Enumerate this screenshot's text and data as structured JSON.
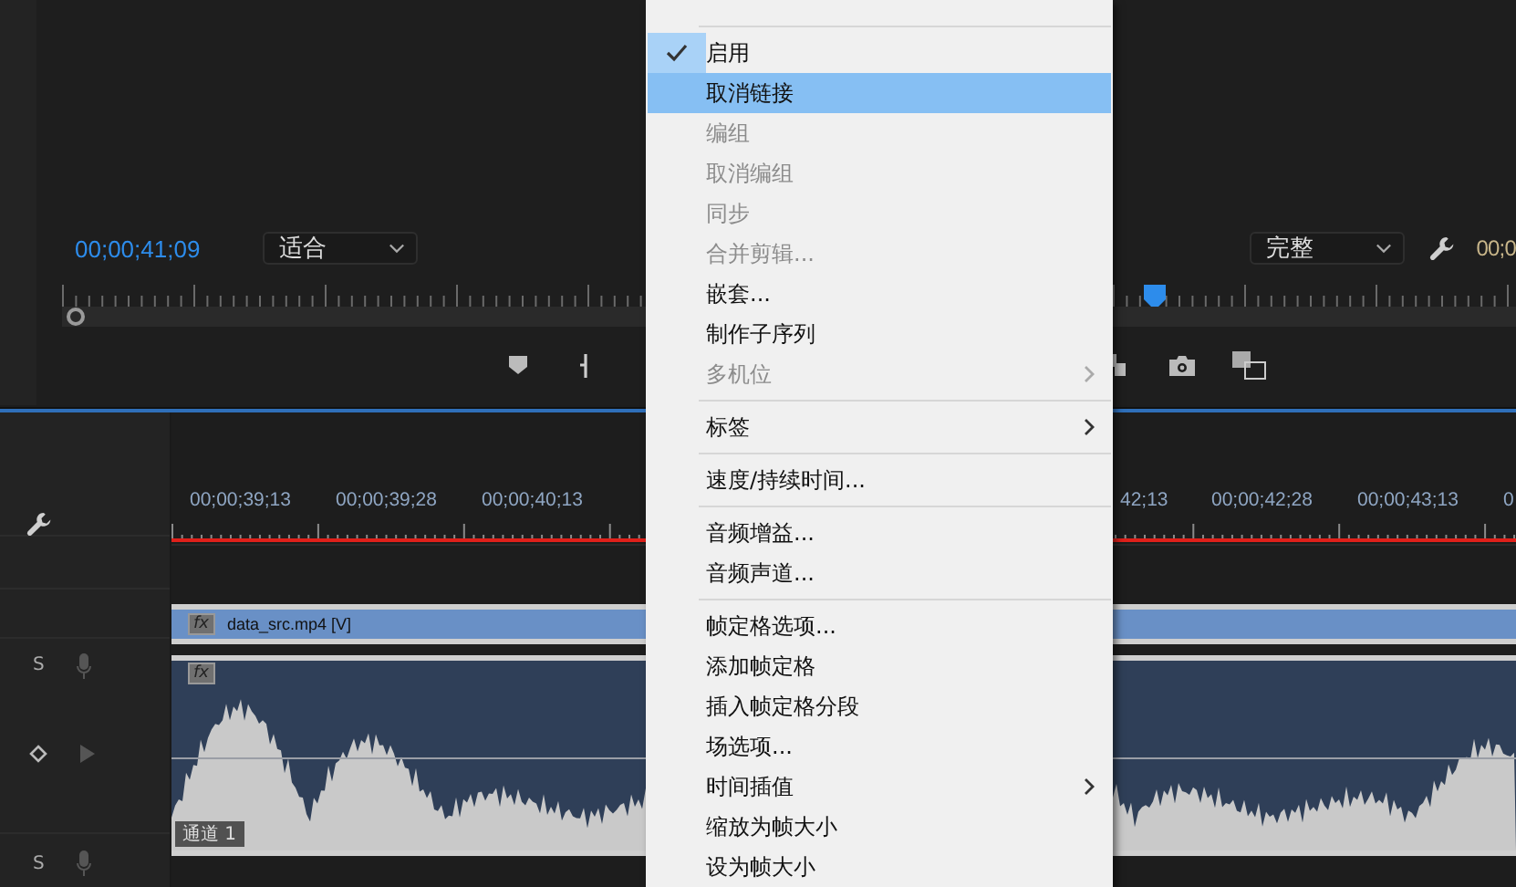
{
  "monitor": {
    "timecode": "00;00;41;09",
    "zoom_select": "适合",
    "quality_select": "完整",
    "timecode_right": "00;0"
  },
  "timeline": {
    "ruler_labels": [
      "00;00;39;13",
      "00;00;39;28",
      "00;00;40;13",
      "42;13",
      "00;00;42;28",
      "00;00;43;13",
      "0"
    ],
    "video_clip": {
      "fx": "fx",
      "name": "data_src.mp4 [V]"
    },
    "audio_clip": {
      "fx": "fx",
      "channel": "通道 1"
    },
    "audio_tracks": [
      {
        "solo": "S"
      },
      {
        "solo": "S"
      }
    ]
  },
  "context_menu": [
    {
      "kind": "separator"
    },
    {
      "kind": "item",
      "label": "启用",
      "disabled": false,
      "checked": true,
      "selected": false,
      "submenu": false
    },
    {
      "kind": "item",
      "label": "取消链接",
      "disabled": false,
      "checked": false,
      "selected": true,
      "submenu": false
    },
    {
      "kind": "item",
      "label": "编组",
      "disabled": true,
      "checked": false,
      "selected": false,
      "submenu": false
    },
    {
      "kind": "item",
      "label": "取消编组",
      "disabled": true,
      "checked": false,
      "selected": false,
      "submenu": false
    },
    {
      "kind": "item",
      "label": "同步",
      "disabled": true,
      "checked": false,
      "selected": false,
      "submenu": false
    },
    {
      "kind": "item",
      "label": "合并剪辑...",
      "disabled": true,
      "checked": false,
      "selected": false,
      "submenu": false
    },
    {
      "kind": "item",
      "label": "嵌套...",
      "disabled": false,
      "checked": false,
      "selected": false,
      "submenu": false
    },
    {
      "kind": "item",
      "label": "制作子序列",
      "disabled": false,
      "checked": false,
      "selected": false,
      "submenu": false
    },
    {
      "kind": "item",
      "label": "多机位",
      "disabled": true,
      "checked": false,
      "selected": false,
      "submenu": true
    },
    {
      "kind": "separator"
    },
    {
      "kind": "item",
      "label": "标签",
      "disabled": false,
      "checked": false,
      "selected": false,
      "submenu": true
    },
    {
      "kind": "separator"
    },
    {
      "kind": "item",
      "label": "速度/持续时间...",
      "disabled": false,
      "checked": false,
      "selected": false,
      "submenu": false
    },
    {
      "kind": "separator"
    },
    {
      "kind": "item",
      "label": "音频增益...",
      "disabled": false,
      "checked": false,
      "selected": false,
      "submenu": false
    },
    {
      "kind": "item",
      "label": "音频声道...",
      "disabled": false,
      "checked": false,
      "selected": false,
      "submenu": false
    },
    {
      "kind": "separator"
    },
    {
      "kind": "item",
      "label": "帧定格选项...",
      "disabled": false,
      "checked": false,
      "selected": false,
      "submenu": false
    },
    {
      "kind": "item",
      "label": "添加帧定格",
      "disabled": false,
      "checked": false,
      "selected": false,
      "submenu": false
    },
    {
      "kind": "item",
      "label": "插入帧定格分段",
      "disabled": false,
      "checked": false,
      "selected": false,
      "submenu": false
    },
    {
      "kind": "item",
      "label": "场选项...",
      "disabled": false,
      "checked": false,
      "selected": false,
      "submenu": false
    },
    {
      "kind": "item",
      "label": "时间插值",
      "disabled": false,
      "checked": false,
      "selected": false,
      "submenu": true
    },
    {
      "kind": "item",
      "label": "缩放为帧大小",
      "disabled": false,
      "checked": false,
      "selected": false,
      "submenu": false
    },
    {
      "kind": "item",
      "label": "设为帧大小",
      "disabled": false,
      "checked": false,
      "selected": false,
      "submenu": false
    }
  ]
}
